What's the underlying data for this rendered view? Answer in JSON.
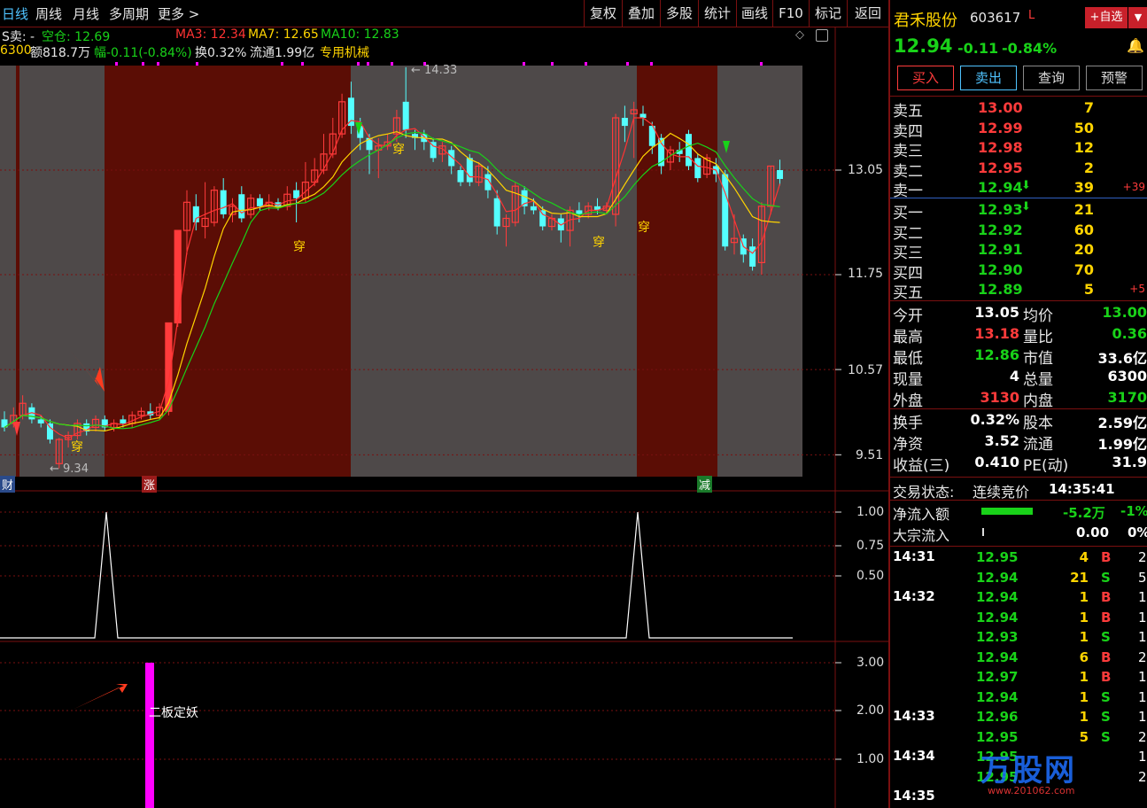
{
  "toolbar": {
    "tabs": [
      "日线",
      "周线",
      "月线",
      "多周期",
      "更多 >"
    ],
    "buttons": [
      "复权",
      "叠加",
      "多股",
      "统计",
      "画线",
      "F10",
      "标记",
      "返回"
    ]
  },
  "info": {
    "line1": {
      "signal": "S卖: -",
      "position": "空仓: 12.69",
      "ma3": "MA3: 12.34",
      "ma7": "MA7: 12.65",
      "ma10": "MA10: 12.83"
    },
    "line2": {
      "vol": "6300",
      "amount": "额818.7万",
      "change": "幅-0.11(-0.84%)",
      "turnover": "换0.32%",
      "float": "流通1.99亿",
      "indicator": "专用机械"
    }
  },
  "chart": {
    "price_axis": [
      "13.05",
      "11.75",
      "10.57",
      "9.51"
    ],
    "high_label": "14.33",
    "low_label": "9.34",
    "markers": [
      "穿",
      "穿",
      "穿",
      "穿",
      "穿"
    ],
    "bottom_tags": [
      "财",
      "涨",
      "减"
    ],
    "sub1_axis": [
      "1.00",
      "0.75",
      "0.50"
    ],
    "sub2_axis": [
      "3.00",
      "2.00",
      "1.00"
    ],
    "sub2_label": "二板定妖",
    "colors": {
      "up": "#ff3b3b",
      "down": "#54ffff",
      "ma3": "#ff3333",
      "ma7": "#ffd400",
      "ma10": "#19d219",
      "magenta": "#ff00ff",
      "band_red": "#5b0d05",
      "band_gray": "#4e4949"
    }
  },
  "chart_data": {
    "type": "candlestick",
    "title": "",
    "yticks": [
      13.05,
      11.75,
      10.57,
      9.51
    ],
    "high": 14.33,
    "low": 9.34,
    "candles": [
      {
        "o": 9.95,
        "c": 9.85,
        "h": 10.05,
        "l": 9.8
      },
      {
        "o": 9.9,
        "c": 10.0,
        "h": 10.1,
        "l": 9.85
      },
      {
        "o": 10.0,
        "c": 10.15,
        "h": 10.25,
        "l": 9.95
      },
      {
        "o": 10.1,
        "c": 9.95,
        "h": 10.15,
        "l": 9.9
      },
      {
        "o": 9.95,
        "c": 9.9,
        "h": 10.0,
        "l": 9.85
      },
      {
        "o": 9.9,
        "c": 9.7,
        "h": 9.95,
        "l": 9.65
      },
      {
        "o": 9.4,
        "c": 9.7,
        "h": 9.72,
        "l": 9.34
      },
      {
        "o": 9.7,
        "c": 9.75,
        "h": 9.8,
        "l": 9.6
      },
      {
        "o": 9.75,
        "c": 9.9,
        "h": 9.95,
        "l": 9.7
      },
      {
        "o": 9.9,
        "c": 9.8,
        "h": 9.95,
        "l": 9.75
      },
      {
        "o": 9.85,
        "c": 9.95,
        "h": 10.0,
        "l": 9.8
      },
      {
        "o": 9.95,
        "c": 9.85,
        "h": 10.0,
        "l": 9.8
      },
      {
        "o": 9.85,
        "c": 9.9,
        "h": 9.95,
        "l": 9.8
      },
      {
        "o": 9.95,
        "c": 9.9,
        "h": 10.0,
        "l": 9.85
      },
      {
        "o": 9.9,
        "c": 10.0,
        "h": 10.05,
        "l": 9.85
      },
      {
        "o": 10.0,
        "c": 10.05,
        "h": 10.1,
        "l": 9.95
      },
      {
        "o": 10.05,
        "c": 10.0,
        "h": 10.15,
        "l": 9.95
      },
      {
        "o": 10.0,
        "c": 10.1,
        "h": 10.15,
        "l": 9.95
      },
      {
        "o": 10.05,
        "c": 11.15,
        "h": 11.15,
        "l": 10.0
      },
      {
        "o": 11.15,
        "c": 12.3,
        "h": 12.3,
        "l": 11.1
      },
      {
        "o": 12.3,
        "c": 12.65,
        "h": 12.8,
        "l": 12.0
      },
      {
        "o": 12.6,
        "c": 12.4,
        "h": 12.75,
        "l": 12.3
      },
      {
        "o": 12.35,
        "c": 12.45,
        "h": 12.9,
        "l": 12.2
      },
      {
        "o": 12.4,
        "c": 12.8,
        "h": 12.85,
        "l": 12.35
      },
      {
        "o": 12.8,
        "c": 12.5,
        "h": 12.95,
        "l": 12.45
      },
      {
        "o": 12.5,
        "c": 12.6,
        "h": 12.7,
        "l": 12.4
      },
      {
        "o": 12.75,
        "c": 12.45,
        "h": 12.85,
        "l": 12.4
      },
      {
        "o": 12.5,
        "c": 12.7,
        "h": 12.75,
        "l": 12.45
      },
      {
        "o": 12.7,
        "c": 12.6,
        "h": 12.75,
        "l": 12.55
      },
      {
        "o": 12.6,
        "c": 12.65,
        "h": 12.75,
        "l": 12.55
      },
      {
        "o": 12.65,
        "c": 12.6,
        "h": 12.7,
        "l": 12.55
      },
      {
        "o": 12.6,
        "c": 12.75,
        "h": 12.85,
        "l": 12.55
      },
      {
        "o": 12.8,
        "c": 12.7,
        "h": 12.9,
        "l": 12.4
      },
      {
        "o": 12.7,
        "c": 12.9,
        "h": 13.15,
        "l": 12.65
      },
      {
        "o": 12.9,
        "c": 13.05,
        "h": 13.2,
        "l": 12.85
      },
      {
        "o": 13.05,
        "c": 13.25,
        "h": 13.5,
        "l": 13.0
      },
      {
        "o": 13.25,
        "c": 13.5,
        "h": 13.7,
        "l": 13.2
      },
      {
        "o": 13.5,
        "c": 13.9,
        "h": 14.0,
        "l": 13.45
      },
      {
        "o": 13.95,
        "c": 13.6,
        "h": 14.15,
        "l": 13.5
      },
      {
        "o": 13.6,
        "c": 13.45,
        "h": 13.7,
        "l": 13.3
      },
      {
        "o": 13.45,
        "c": 13.3,
        "h": 13.5,
        "l": 13.0
      },
      {
        "o": 13.3,
        "c": 13.35,
        "h": 13.45,
        "l": 12.95
      },
      {
        "o": 13.35,
        "c": 13.4,
        "h": 13.5,
        "l": 13.3
      },
      {
        "o": 13.5,
        "c": 13.7,
        "h": 13.8,
        "l": 13.4
      },
      {
        "o": 13.9,
        "c": 13.55,
        "h": 14.33,
        "l": 13.45
      },
      {
        "o": 13.5,
        "c": 13.45,
        "h": 13.55,
        "l": 13.3
      },
      {
        "o": 13.5,
        "c": 13.4,
        "h": 13.55,
        "l": 13.3
      },
      {
        "o": 13.4,
        "c": 13.2,
        "h": 13.45,
        "l": 13.15
      },
      {
        "o": 13.25,
        "c": 13.35,
        "h": 13.4,
        "l": 13.15
      },
      {
        "o": 13.3,
        "c": 13.1,
        "h": 13.35,
        "l": 13.0
      },
      {
        "o": 13.05,
        "c": 12.9,
        "h": 13.1,
        "l": 12.85
      },
      {
        "o": 13.2,
        "c": 12.9,
        "h": 13.25,
        "l": 12.85
      },
      {
        "o": 12.9,
        "c": 13.1,
        "h": 13.15,
        "l": 12.85
      },
      {
        "o": 13.0,
        "c": 12.8,
        "h": 13.1,
        "l": 12.7
      },
      {
        "o": 12.7,
        "c": 12.35,
        "h": 12.8,
        "l": 12.25
      },
      {
        "o": 12.35,
        "c": 12.45,
        "h": 12.5,
        "l": 12.1
      },
      {
        "o": 12.4,
        "c": 12.85,
        "h": 12.9,
        "l": 12.35
      },
      {
        "o": 12.8,
        "c": 12.6,
        "h": 12.85,
        "l": 12.5
      },
      {
        "o": 12.6,
        "c": 12.55,
        "h": 12.7,
        "l": 12.5
      },
      {
        "o": 12.55,
        "c": 12.35,
        "h": 12.6,
        "l": 12.3
      },
      {
        "o": 12.35,
        "c": 12.45,
        "h": 12.5,
        "l": 12.3
      },
      {
        "o": 12.45,
        "c": 12.3,
        "h": 12.5,
        "l": 12.15
      },
      {
        "o": 12.3,
        "c": 12.55,
        "h": 12.6,
        "l": 12.1
      },
      {
        "o": 12.55,
        "c": 12.5,
        "h": 12.65,
        "l": 12.4
      },
      {
        "o": 12.5,
        "c": 12.6,
        "h": 12.65,
        "l": 12.45
      },
      {
        "o": 12.6,
        "c": 12.55,
        "h": 12.7,
        "l": 12.5
      },
      {
        "o": 12.55,
        "c": 12.6,
        "h": 12.65,
        "l": 12.5
      },
      {
        "o": 12.5,
        "c": 13.7,
        "h": 13.75,
        "l": 12.35
      },
      {
        "o": 13.7,
        "c": 13.6,
        "h": 13.85,
        "l": 13.4
      },
      {
        "o": 13.75,
        "c": 13.8,
        "h": 13.9,
        "l": 13.2
      },
      {
        "o": 13.75,
        "c": 13.7,
        "h": 13.85,
        "l": 13.6
      },
      {
        "o": 13.6,
        "c": 13.35,
        "h": 13.65,
        "l": 13.25
      },
      {
        "o": 13.45,
        "c": 13.1,
        "h": 13.5,
        "l": 13.0
      },
      {
        "o": 13.15,
        "c": 13.3,
        "h": 13.35,
        "l": 13.05
      },
      {
        "o": 13.3,
        "c": 13.25,
        "h": 13.4,
        "l": 13.15
      },
      {
        "o": 13.5,
        "c": 13.1,
        "h": 13.55,
        "l": 13.05
      },
      {
        "o": 13.2,
        "c": 12.95,
        "h": 13.25,
        "l": 12.9
      },
      {
        "o": 13.0,
        "c": 13.2,
        "h": 13.25,
        "l": 12.95
      },
      {
        "o": 13.1,
        "c": 13.0,
        "h": 13.2,
        "l": 12.9
      },
      {
        "o": 13.0,
        "c": 12.1,
        "h": 13.05,
        "l": 12.05
      },
      {
        "o": 12.15,
        "c": 12.2,
        "h": 12.5,
        "l": 12.0
      },
      {
        "o": 12.2,
        "c": 12.0,
        "h": 12.25,
        "l": 11.9
      },
      {
        "o": 12.1,
        "c": 11.85,
        "h": 12.2,
        "l": 11.8
      },
      {
        "o": 11.9,
        "c": 12.6,
        "h": 12.65,
        "l": 11.75
      },
      {
        "o": 12.6,
        "c": 13.1,
        "h": 13.1,
        "l": 12.5
      },
      {
        "o": 13.05,
        "c": 12.94,
        "h": 13.18,
        "l": 12.86
      }
    ]
  },
  "stock": {
    "name": "君禾股份",
    "code": "603617",
    "tag": "L",
    "add_fav": "+自选",
    "price": "12.94",
    "change": "-0.11",
    "pct": "-0.84%"
  },
  "actions": [
    "买入",
    "卖出",
    "查询",
    "预警"
  ],
  "asks": [
    {
      "label": "卖五",
      "price": "13.00",
      "vol": "7",
      "extra": ""
    },
    {
      "label": "卖四",
      "price": "12.99",
      "vol": "50",
      "extra": ""
    },
    {
      "label": "卖三",
      "price": "12.98",
      "vol": "12",
      "extra": ""
    },
    {
      "label": "卖二",
      "price": "12.95",
      "vol": "2",
      "extra": ""
    },
    {
      "label": "卖一",
      "price": "12.94",
      "vol": "39",
      "extra": "+39"
    }
  ],
  "bids": [
    {
      "label": "买一",
      "price": "12.93",
      "vol": "21",
      "extra": ""
    },
    {
      "label": "买二",
      "price": "12.92",
      "vol": "60",
      "extra": ""
    },
    {
      "label": "买三",
      "price": "12.91",
      "vol": "20",
      "extra": ""
    },
    {
      "label": "买四",
      "price": "12.90",
      "vol": "70",
      "extra": ""
    },
    {
      "label": "买五",
      "price": "12.89",
      "vol": "5",
      "extra": "+5"
    }
  ],
  "stats": [
    {
      "l1": "今开",
      "v1": "13.05",
      "l2": "均价",
      "v2": "13.00"
    },
    {
      "l1": "最高",
      "v1": "13.18",
      "l2": "量比",
      "v2": "0.36"
    },
    {
      "l1": "最低",
      "v1": "12.86",
      "l2": "市值",
      "v2": "33.6亿"
    },
    {
      "l1": "现量",
      "v1": "4",
      "l2": "总量",
      "v2": "6300"
    },
    {
      "l1": "外盘",
      "v1": "3130",
      "l2": "内盘",
      "v2": "3170"
    }
  ],
  "stats2": [
    {
      "l1": "换手",
      "v1": "0.32%",
      "l2": "股本",
      "v2": "2.59亿"
    },
    {
      "l1": "净资",
      "v1": "3.52",
      "l2": "流通",
      "v2": "1.99亿"
    },
    {
      "l1": "收益(三)",
      "v1": "0.410",
      "l2": "PE(动)",
      "v2": "31.9"
    }
  ],
  "trade_status": {
    "label": "交易状态:",
    "value": "连续竞价",
    "time": "14:35:41"
  },
  "flow": {
    "net_label": "净流入额",
    "net_value": "-5.2万",
    "net_pct": "-1%",
    "block_label": "大宗流入",
    "block_value": "0.00",
    "block_pct": "0%"
  },
  "ticks": [
    {
      "time": "14:31",
      "price": "12.95",
      "vol": "4",
      "side": "B",
      "n": "2"
    },
    {
      "time": "",
      "price": "12.94",
      "vol": "21",
      "side": "S",
      "n": "5"
    },
    {
      "time": "14:32",
      "price": "12.94",
      "vol": "1",
      "side": "B",
      "n": "1"
    },
    {
      "time": "",
      "price": "12.94",
      "vol": "1",
      "side": "B",
      "n": "1"
    },
    {
      "time": "",
      "price": "12.93",
      "vol": "1",
      "side": "S",
      "n": "1"
    },
    {
      "time": "",
      "price": "12.94",
      "vol": "6",
      "side": "B",
      "n": "2"
    },
    {
      "time": "",
      "price": "12.97",
      "vol": "1",
      "side": "B",
      "n": "1"
    },
    {
      "time": "",
      "price": "12.94",
      "vol": "1",
      "side": "S",
      "n": "1"
    },
    {
      "time": "14:33",
      "price": "12.96",
      "vol": "1",
      "side": "S",
      "n": "1"
    },
    {
      "time": "",
      "price": "12.95",
      "vol": "5",
      "side": "S",
      "n": "2"
    },
    {
      "time": "14:34",
      "price": "12.95",
      "vol": "",
      "side": "",
      "n": "1"
    },
    {
      "time": "",
      "price": "12.95",
      "vol": "",
      "side": "",
      "n": "2"
    },
    {
      "time": "14:35",
      "price": "",
      "vol": "",
      "side": "",
      "n": ""
    }
  ],
  "watermark": {
    "text": "万股网",
    "url": "www.201062.com"
  }
}
